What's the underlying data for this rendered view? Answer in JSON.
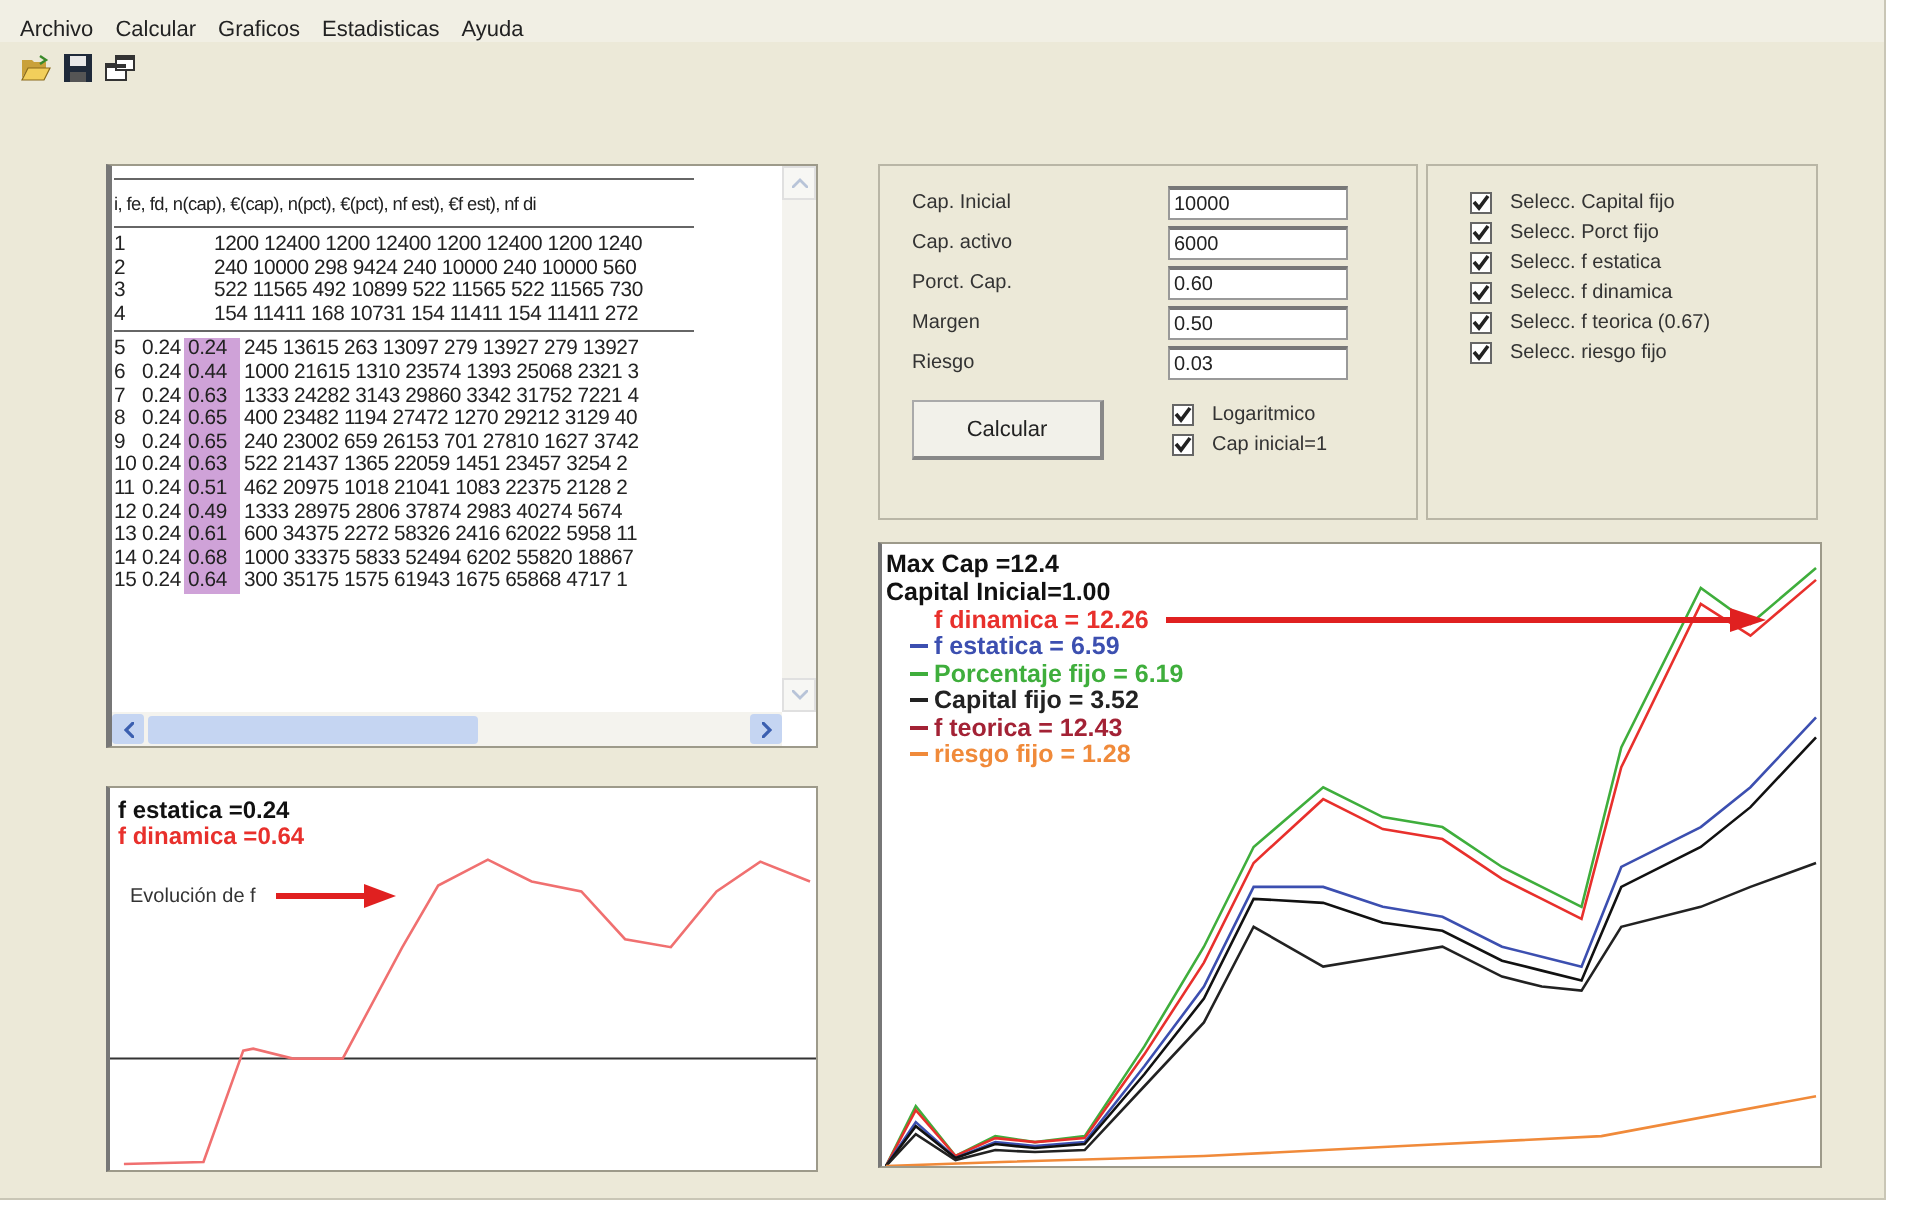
{
  "menu": [
    "Archivo",
    "Calcular",
    "Graficos",
    "Estadisticas",
    "Ayuda"
  ],
  "table": {
    "header": "i, fe, fd, n(cap), €(cap), n(pct), €(pct), nf est), €f est), nf di",
    "top_rows": [
      {
        "i": "1",
        "values": "1200 12400 1200 12400 1200 12400 1200 1240"
      },
      {
        "i": "2",
        "values": "240 10000 298 9424 240 10000 240 10000 560"
      },
      {
        "i": "3",
        "values": "522 11565 492 10899 522 11565 522 11565 730"
      },
      {
        "i": "4",
        "values": "154 11411 168 10731 154 11411 154 11411 272"
      }
    ],
    "rows": [
      {
        "i": "5",
        "fe": "0.24",
        "fd": "0.24",
        "values": "245 13615 263 13097 279 13927 279 13927"
      },
      {
        "i": "6",
        "fe": "0.24",
        "fd": "0.44",
        "values": "1000 21615 1310 23574 1393 25068 2321 3"
      },
      {
        "i": "7",
        "fe": "0.24",
        "fd": "0.63",
        "values": "1333 24282 3143 29860 3342 31752 7221 4"
      },
      {
        "i": "8",
        "fe": "0.24",
        "fd": "0.65",
        "values": "400 23482 1194 27472 1270 29212 3129 40"
      },
      {
        "i": "9",
        "fe": "0.24",
        "fd": "0.65",
        "values": "240 23002 659 26153 701 27810 1627 3742"
      },
      {
        "i": "10",
        "fe": "0.24",
        "fd": "0.63",
        "values": "522 21437 1365 22059 1451 23457 3254 2"
      },
      {
        "i": "11",
        "fe": "0.24",
        "fd": "0.51",
        "values": "462 20975 1018 21041 1083 22375 2128 2"
      },
      {
        "i": "12",
        "fe": "0.24",
        "fd": "0.49",
        "values": "1333 28975 2806 37874 2983 40274 5674"
      },
      {
        "i": "13",
        "fe": "0.24",
        "fd": "0.61",
        "values": "600 34375 2272 58326 2416 62022 5958 11"
      },
      {
        "i": "14",
        "fe": "0.24",
        "fd": "0.68",
        "values": "1000 33375 5833 52494 6202 55820 18867"
      },
      {
        "i": "15",
        "fe": "0.24",
        "fd": "0.64",
        "values": "300 35175 1575 61943 1675 65868 4717 1"
      }
    ]
  },
  "params": [
    {
      "label": "Cap. Inicial",
      "value": "10000"
    },
    {
      "label": "Cap. activo",
      "value": "6000"
    },
    {
      "label": "Porct. Cap.",
      "value": "0.60"
    },
    {
      "label": "Margen",
      "value": "0.50"
    },
    {
      "label": "Riesgo",
      "value": "0.03"
    }
  ],
  "calc_button": "Calcular",
  "options": [
    {
      "label": "Logaritmico",
      "checked": true
    },
    {
      "label": "Cap inicial=1",
      "checked": true
    }
  ],
  "selections": [
    {
      "label": "Selecc. Capital fijo",
      "checked": true
    },
    {
      "label": "Selecc. Porct fijo",
      "checked": true
    },
    {
      "label": "Selecc. f estatica",
      "checked": true
    },
    {
      "label": "Selecc. f dinamica",
      "checked": true
    },
    {
      "label": "Selecc. f teorica  (0.67)",
      "checked": true
    },
    {
      "label": "Selecc. riesgo fijo",
      "checked": true
    }
  ],
  "f_chart": {
    "legend": [
      {
        "text": "f estatica =0.24",
        "color": "#111111"
      },
      {
        "text": "f dinamica =0.64",
        "color": "#e8302c"
      }
    ],
    "annotation": "Evolución de f"
  },
  "cap_chart": {
    "legend": [
      {
        "kind": "heading",
        "text": "Max Cap =12.4",
        "color": "#111111"
      },
      {
        "kind": "heading",
        "text": "Capital Inicial=1.00",
        "color": "#111111"
      },
      {
        "kind": "series",
        "text": "f dinamica = 12.26",
        "color": "#e8302c",
        "swatch": false,
        "arrow": true
      },
      {
        "kind": "series",
        "text": "f estatica = 6.59",
        "color": "#3c4fb0",
        "swatch": true
      },
      {
        "kind": "series",
        "text": "Porcentaje fijo = 6.19",
        "color": "#3fae3c",
        "swatch": true
      },
      {
        "kind": "series",
        "text": "Capital fijo = 3.52",
        "color": "#222222",
        "swatch": true
      },
      {
        "kind": "series",
        "text": "f teorica = 12.43",
        "color": "#a32235",
        "swatch": true
      },
      {
        "kind": "series",
        "text": "riesgo fijo = 1.28",
        "color": "#f08a3a",
        "swatch": true
      }
    ]
  }
}
